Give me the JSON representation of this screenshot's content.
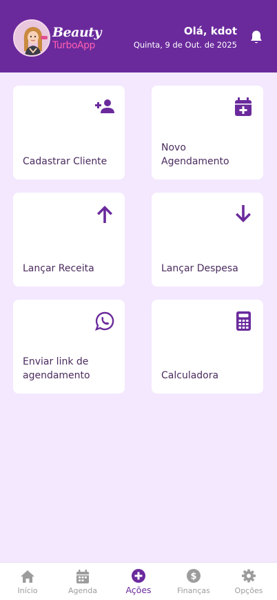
{
  "header": {
    "brand_line1": "Beauty",
    "brand_line2": "TurboApp",
    "greeting": "Olá, kdot",
    "date": "Quinta, 9 de Out. de 2025",
    "bell_icon": "bell-icon"
  },
  "colors": {
    "primary": "#6a2a9c",
    "background": "#f3e8fd",
    "card": "#ffffff",
    "card_text": "#4a2b5e",
    "brand_pink": "#ff5fb0",
    "nav_inactive": "#9c9c9c"
  },
  "actions": [
    {
      "label": "Cadastrar Cliente",
      "icon": "person-add-icon"
    },
    {
      "label": "Novo Agendamento",
      "icon": "calendar-plus-icon"
    },
    {
      "label": "Lançar Receita",
      "icon": "arrow-up-icon"
    },
    {
      "label": "Lançar Despesa",
      "icon": "arrow-down-icon"
    },
    {
      "label": "Enviar link de agendamento",
      "icon": "whatsapp-icon"
    },
    {
      "label": "Calculadora",
      "icon": "calculator-icon"
    }
  ],
  "nav": {
    "items": [
      {
        "label": "Início",
        "icon": "home-icon",
        "active": false
      },
      {
        "label": "Agenda",
        "icon": "calendar-icon",
        "active": false
      },
      {
        "label": "Ações",
        "icon": "plus-circle-icon",
        "active": true
      },
      {
        "label": "Finanças",
        "icon": "dollar-circle-icon",
        "active": false
      },
      {
        "label": "Opções",
        "icon": "gear-icon",
        "active": false
      }
    ]
  }
}
